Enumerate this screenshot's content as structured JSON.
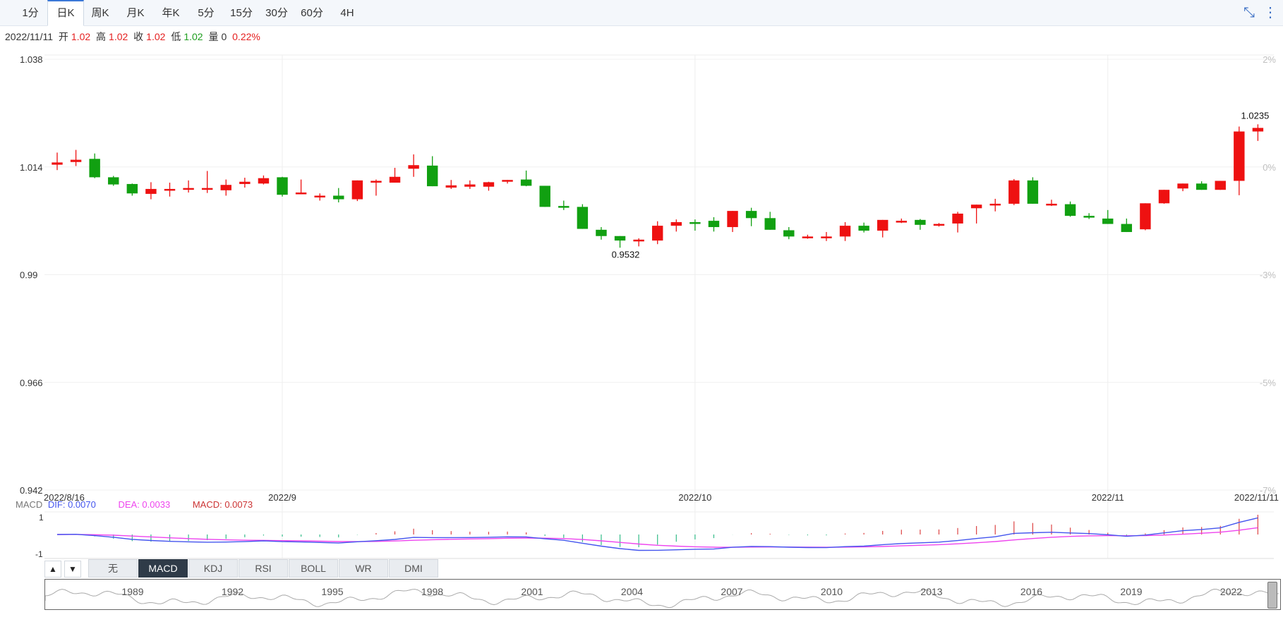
{
  "tabs": [
    "1分",
    "日K",
    "周K",
    "月K",
    "年K",
    "5分",
    "15分",
    "30分",
    "60分",
    "4H"
  ],
  "active_tab": "日K",
  "toolbar_icons": [
    "collapse-icon",
    "more-icon"
  ],
  "info": {
    "date": "2022/11/11",
    "open_label": "开",
    "open": "1.02",
    "high_label": "高",
    "high": "1.02",
    "close_label": "收",
    "close": "1.02",
    "low_label": "低",
    "low": "1.02",
    "vol_label": "量",
    "vol": "0",
    "change": "0.22%"
  },
  "colors": {
    "up": "#ee1111",
    "down": "#11a011",
    "dif": "#4455ee",
    "dea": "#ee44ee",
    "macd": "#cc3333"
  },
  "chart_data": {
    "type": "candlestick",
    "y_ticks": [
      "1.038",
      "1.014",
      "0.99",
      "0.966",
      "0.942"
    ],
    "y_pct_ticks": [
      "2%",
      "0%",
      "-3%",
      "-5%",
      "-7%"
    ],
    "ylim": [
      0.942,
      1.038
    ],
    "x_labels": [
      {
        "label": "2022/8/16",
        "index": 0
      },
      {
        "label": "2022/9",
        "index": 12
      },
      {
        "label": "2022/10",
        "index": 34
      },
      {
        "label": "2022/11",
        "index": 56
      },
      {
        "label": "2022/11/11",
        "index": 64
      }
    ],
    "max_label": "1.0235",
    "min_label": "0.9532",
    "candles": [
      {
        "o": 1.0145,
        "h": 1.0172,
        "l": 1.0133,
        "c": 1.015
      },
      {
        "o": 1.0151,
        "h": 1.0178,
        "l": 1.0142,
        "c": 1.0156
      },
      {
        "o": 1.0158,
        "h": 1.017,
        "l": 1.0115,
        "c": 1.0117
      },
      {
        "o": 1.0117,
        "h": 1.012,
        "l": 1.0098,
        "c": 1.0101
      },
      {
        "o": 1.0102,
        "h": 1.0103,
        "l": 1.0076,
        "c": 1.0081
      },
      {
        "o": 1.008,
        "h": 1.0106,
        "l": 1.0068,
        "c": 1.0091
      },
      {
        "o": 1.0089,
        "h": 1.0105,
        "l": 1.0074,
        "c": 1.0091
      },
      {
        "o": 1.009,
        "h": 1.011,
        "l": 1.0083,
        "c": 1.0093
      },
      {
        "o": 1.0091,
        "h": 1.0131,
        "l": 1.0082,
        "c": 1.0093
      },
      {
        "o": 1.0088,
        "h": 1.0112,
        "l": 1.0076,
        "c": 1.01
      },
      {
        "o": 1.0102,
        "h": 1.0116,
        "l": 1.0094,
        "c": 1.0107
      },
      {
        "o": 1.0103,
        "h": 1.0121,
        "l": 1.0101,
        "c": 1.0115
      },
      {
        "o": 1.0117,
        "h": 1.0118,
        "l": 1.0074,
        "c": 1.0078
      },
      {
        "o": 1.0081,
        "h": 1.0112,
        "l": 1.008,
        "c": 1.0083
      },
      {
        "o": 1.0073,
        "h": 1.0081,
        "l": 1.0065,
        "c": 1.0076
      },
      {
        "o": 1.0076,
        "h": 1.0093,
        "l": 1.0061,
        "c": 1.0068
      },
      {
        "o": 1.0068,
        "h": 1.0109,
        "l": 1.0064,
        "c": 1.011
      },
      {
        "o": 1.0106,
        "h": 1.0112,
        "l": 1.0076,
        "c": 1.0109
      },
      {
        "o": 1.0105,
        "h": 1.0138,
        "l": 1.0105,
        "c": 1.0118
      },
      {
        "o": 1.0136,
        "h": 1.0168,
        "l": 1.0118,
        "c": 1.0144
      },
      {
        "o": 1.0143,
        "h": 1.0164,
        "l": 1.0097,
        "c": 1.0097
      },
      {
        "o": 1.0094,
        "h": 1.0111,
        "l": 1.0091,
        "c": 1.0099
      },
      {
        "o": 1.0096,
        "h": 1.011,
        "l": 1.0091,
        "c": 1.0101
      },
      {
        "o": 1.0096,
        "h": 1.0107,
        "l": 1.0087,
        "c": 1.0106
      },
      {
        "o": 1.011,
        "h": 1.011,
        "l": 1.0103,
        "c": 1.0111
      },
      {
        "o": 1.0112,
        "h": 1.0132,
        "l": 1.0097,
        "c": 1.0098
      },
      {
        "o": 1.0098,
        "h": 1.0095,
        "l": 1.0061,
        "c": 1.0051
      },
      {
        "o": 1.0053,
        "h": 1.0065,
        "l": 1.0044,
        "c": 1.0051
      },
      {
        "o": 1.0051,
        "h": 1.0057,
        "l": 1.0006,
        "c": 1.0002
      },
      {
        "o": 1.0,
        "h": 1.0006,
        "l": 0.9978,
        "c": 0.9986
      },
      {
        "o": 0.9986,
        "h": 0.9986,
        "l": 0.996,
        "c": 0.9976
      },
      {
        "o": 0.9976,
        "h": 0.9981,
        "l": 0.9963,
        "c": 0.9978
      },
      {
        "o": 0.9976,
        "h": 1.0019,
        "l": 0.9968,
        "c": 1.0009
      },
      {
        "o": 1.0009,
        "h": 1.0023,
        "l": 0.9996,
        "c": 1.0017
      },
      {
        "o": 1.0017,
        "h": 1.0023,
        "l": 0.9998,
        "c": 1.0016
      },
      {
        "o": 1.002,
        "h": 1.0028,
        "l": 0.9996,
        "c": 1.0006
      },
      {
        "o": 1.0006,
        "h": 1.0029,
        "l": 0.9995,
        "c": 1.0042
      },
      {
        "o": 1.0042,
        "h": 1.0049,
        "l": 1.0008,
        "c": 1.0026
      },
      {
        "o": 1.0026,
        "h": 1.004,
        "l": 1.0005,
        "c": 1.0
      },
      {
        "o": 0.9999,
        "h": 1.0006,
        "l": 0.9979,
        "c": 0.9985
      },
      {
        "o": 0.9985,
        "h": 0.9989,
        "l": 0.998,
        "c": 0.9985
      },
      {
        "o": 0.9985,
        "h": 0.9995,
        "l": 0.9975,
        "c": 0.9985
      },
      {
        "o": 0.9985,
        "h": 1.0017,
        "l": 0.9975,
        "c": 1.0009
      },
      {
        "o": 1.0009,
        "h": 1.0016,
        "l": 0.9994,
        "c": 0.9998
      },
      {
        "o": 0.9998,
        "h": 1.0019,
        "l": 0.9983,
        "c": 1.0022
      },
      {
        "o": 1.002,
        "h": 1.0025,
        "l": 1.0015,
        "c": 1.002
      },
      {
        "o": 1.0022,
        "h": 1.0024,
        "l": 1.0,
        "c": 1.0011
      },
      {
        "o": 1.0011,
        "h": 1.0015,
        "l": 1.0007,
        "c": 1.0013
      },
      {
        "o": 1.0014,
        "h": 1.004,
        "l": 0.9994,
        "c": 1.0036
      },
      {
        "o": 1.0048,
        "h": 1.0056,
        "l": 1.0014,
        "c": 1.0056
      },
      {
        "o": 1.0056,
        "h": 1.0069,
        "l": 1.0041,
        "c": 1.0058
      },
      {
        "o": 1.0058,
        "h": 1.0113,
        "l": 1.0055,
        "c": 1.011
      },
      {
        "o": 1.011,
        "h": 1.0117,
        "l": 1.0058,
        "c": 1.0058
      },
      {
        "o": 1.0058,
        "h": 1.0067,
        "l": 1.0053,
        "c": 1.0058
      },
      {
        "o": 1.0057,
        "h": 1.0063,
        "l": 1.0029,
        "c": 1.0031
      },
      {
        "o": 1.0031,
        "h": 1.0037,
        "l": 1.0024,
        "c": 1.003
      },
      {
        "o": 1.0025,
        "h": 1.0044,
        "l": 1.0018,
        "c": 1.0013
      },
      {
        "o": 1.0013,
        "h": 1.0025,
        "l": 1.0007,
        "c": 0.9995
      },
      {
        "o": 1.0001,
        "h": 1.0045,
        "l": 0.9999,
        "c": 1.0059
      },
      {
        "o": 1.0059,
        "h": 1.0075,
        "l": 1.0058,
        "c": 1.0089
      },
      {
        "o": 1.0092,
        "h": 1.0103,
        "l": 1.0086,
        "c": 1.0103
      },
      {
        "o": 1.0103,
        "h": 1.0108,
        "l": 1.0094,
        "c": 1.0089
      },
      {
        "o": 1.0089,
        "h": 1.0097,
        "l": 1.009,
        "c": 1.0109
      },
      {
        "o": 1.0109,
        "h": 1.023,
        "l": 1.0077,
        "c": 1.0219
      },
      {
        "o": 1.0219,
        "h": 1.0235,
        "l": 1.0198,
        "c": 1.0227
      }
    ],
    "macd": {
      "legend_prefix": "MACD",
      "dif_label": "DIF: 0.0070",
      "dea_label": "DEA: 0.0033",
      "macd_label": "MACD: 0.0073",
      "ticks": [
        "1",
        "-1"
      ]
    }
  },
  "indicator_buttons": [
    "无",
    "MACD",
    "KDJ",
    "RSI",
    "BOLL",
    "WR",
    "DMI"
  ],
  "active_indicator": "MACD",
  "arrows": [
    "▲",
    "▼"
  ],
  "navigator_years": [
    "1989",
    "1992",
    "1995",
    "1998",
    "2001",
    "2004",
    "2007",
    "2010",
    "2013",
    "2016",
    "2019",
    "2022"
  ]
}
